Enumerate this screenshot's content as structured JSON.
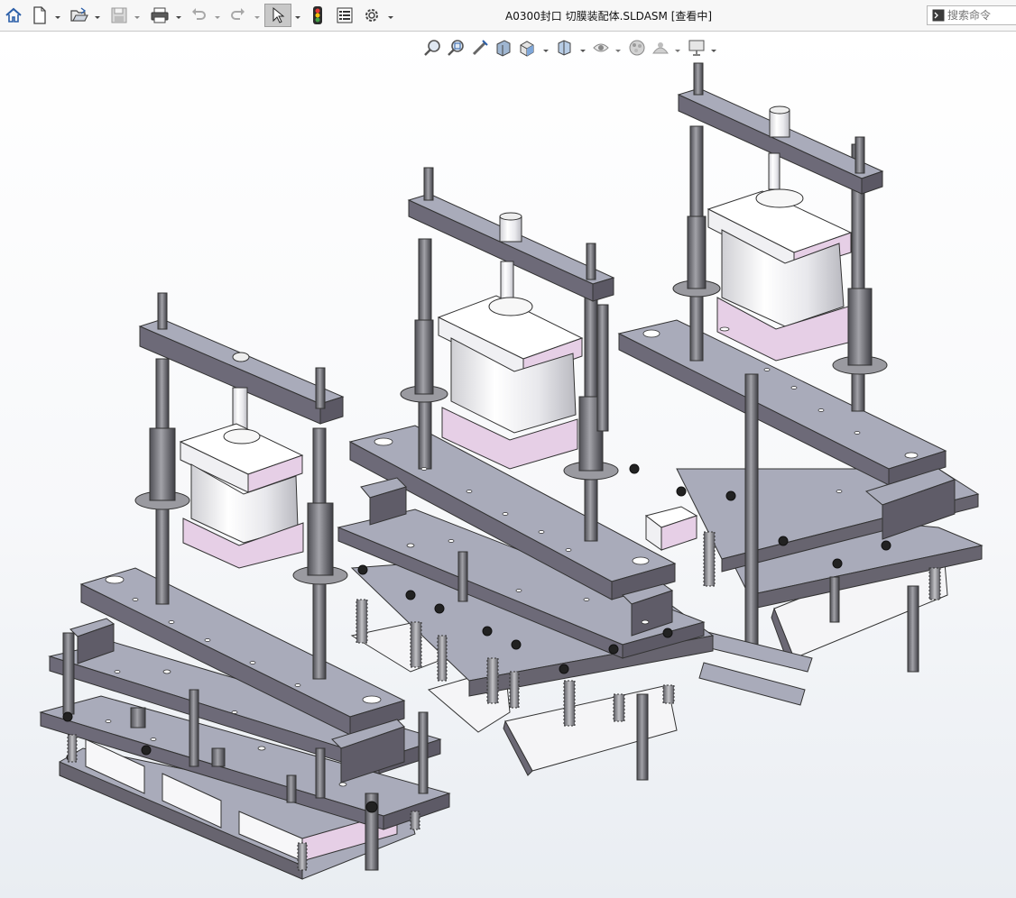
{
  "window": {
    "title": "A0300封口 切膜装配体.SLDASM [查看中]"
  },
  "toolbar": {
    "items": [
      {
        "name": "home-icon"
      },
      {
        "name": "new-document-icon"
      },
      {
        "name": "open-folder-icon"
      },
      {
        "name": "save-icon"
      },
      {
        "name": "print-icon"
      },
      {
        "name": "undo-icon"
      },
      {
        "name": "redo-icon"
      },
      {
        "name": "select-cursor-icon"
      },
      {
        "name": "rebuild-traffic-light-icon"
      },
      {
        "name": "file-properties-icon"
      },
      {
        "name": "options-gear-icon"
      }
    ]
  },
  "search": {
    "placeholder": "搜索命令",
    "icon": "command-prompt-icon"
  },
  "heads_up_toolbar": {
    "items": [
      {
        "name": "zoom-to-fit-icon"
      },
      {
        "name": "zoom-to-area-icon"
      },
      {
        "name": "previous-view-icon"
      },
      {
        "name": "section-view-icon"
      },
      {
        "name": "view-orientation-icon"
      },
      {
        "name": "display-style-icon"
      },
      {
        "name": "hide-show-items-icon"
      },
      {
        "name": "edit-appearance-icon"
      },
      {
        "name": "apply-scene-icon"
      },
      {
        "name": "view-settings-icon"
      }
    ]
  },
  "colors": {
    "plate_top": "#a9abba",
    "plate_side": "#73707e",
    "plate_dark": "#5e5a66",
    "accent_pink": "#e6cfe6",
    "cylinder_white": "#f2f2f4",
    "rod": "#6e6e72",
    "viewport_bg": "#ffffff"
  }
}
